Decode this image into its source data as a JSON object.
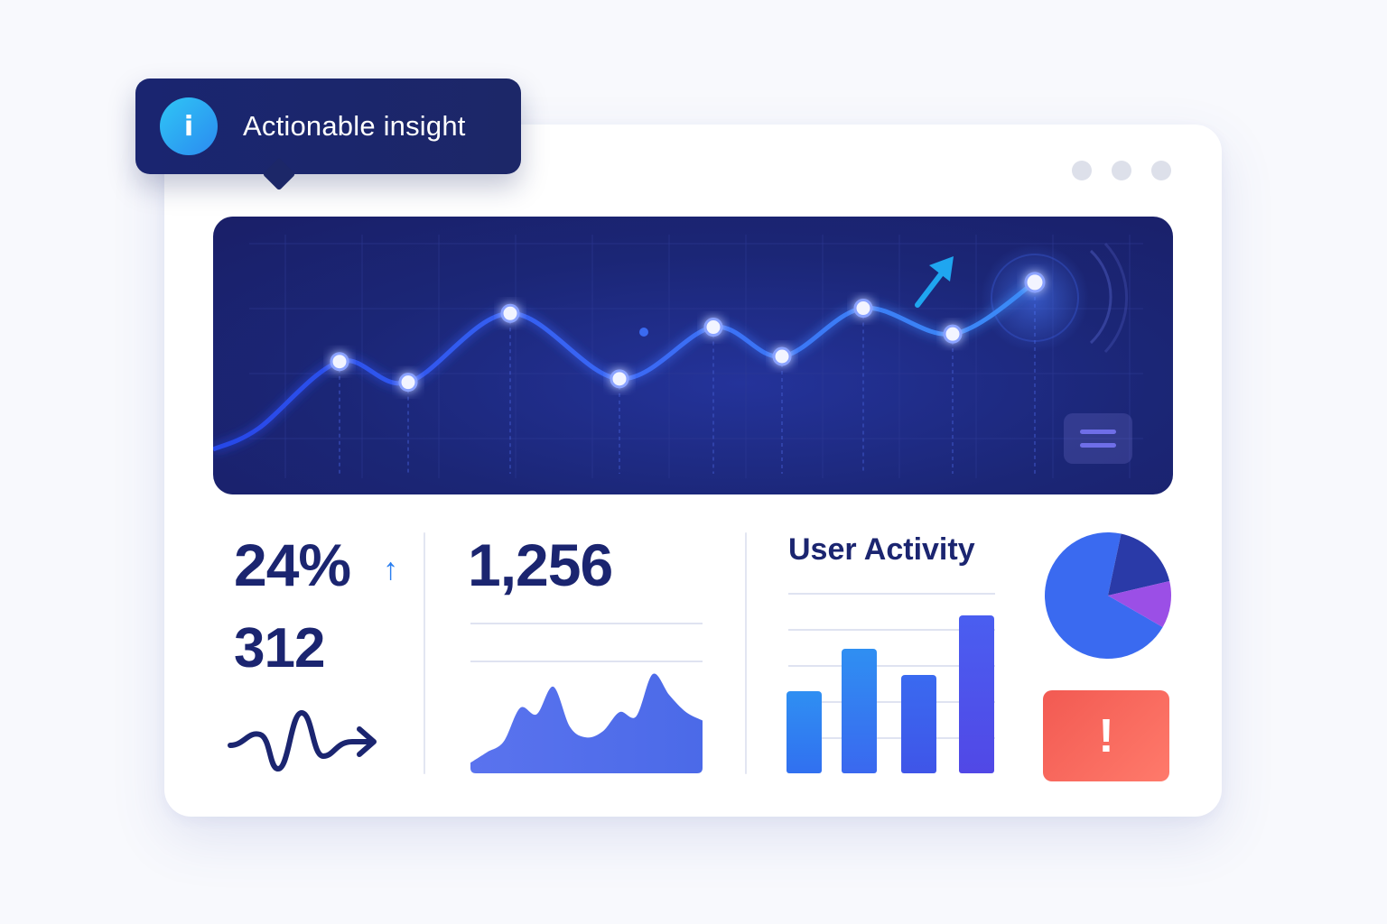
{
  "tooltip": {
    "text": "Actionable insight",
    "icon": "info-icon"
  },
  "window": {
    "controls": [
      "window-dot",
      "window-dot",
      "window-dot"
    ]
  },
  "main_chart": {
    "menu_icon": "hamburger-icon",
    "trend_icon": "arrow-up-right-icon"
  },
  "stats": {
    "percent": "24%",
    "count": "312",
    "total": "1,256",
    "trend_icon": "arrow-up-icon",
    "sparkline_icon": "wave-arrow-icon"
  },
  "activity": {
    "title": "User Activity"
  },
  "alert": {
    "symbol": "!",
    "icon": "alert-icon"
  },
  "colors": {
    "accent": "#2b6ff0",
    "panel": "#1b2676",
    "text": "#1b2570",
    "alert": "#f25a52"
  },
  "chart_data": [
    {
      "type": "line",
      "x": [
        1,
        2,
        3,
        4,
        5,
        6,
        7,
        8,
        9
      ],
      "series": [
        {
          "values": [
            52,
            40,
            80,
            42,
            72,
            55,
            83,
            68,
            98
          ]
        }
      ],
      "grid": true
    },
    {
      "type": "area",
      "values": [
        10,
        20,
        30,
        62,
        56,
        82,
        44,
        34,
        40,
        58,
        54,
        94,
        74,
        58,
        50
      ],
      "grid": true
    },
    {
      "type": "bar",
      "values": [
        50,
        76,
        60,
        96
      ],
      "grid": true
    },
    {
      "type": "pie",
      "values": [
        70,
        18,
        12
      ],
      "colors": [
        "#3a6af0",
        "#2a3aa8",
        "#9b4fe6"
      ]
    }
  ]
}
